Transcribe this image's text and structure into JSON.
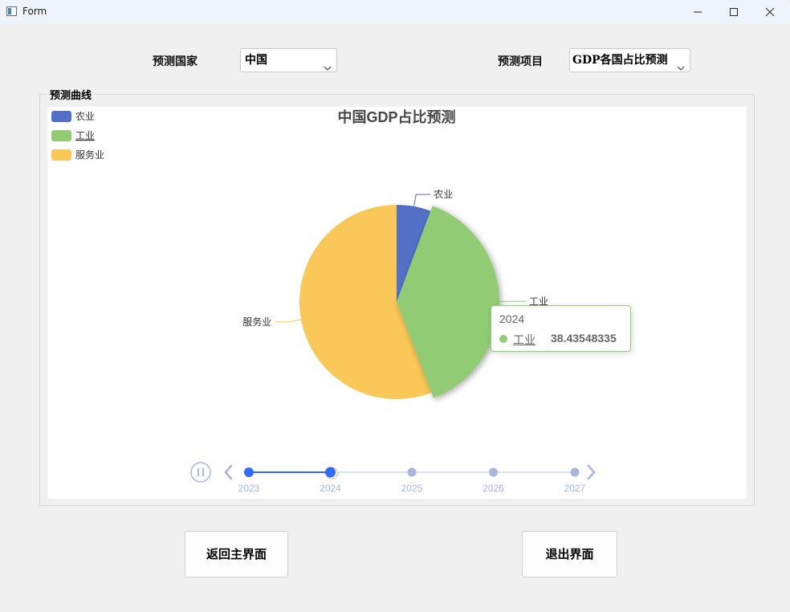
{
  "window": {
    "title": "Form"
  },
  "controls": {
    "country_label": "预测国家",
    "country_value": "中国",
    "item_label": "预测项目",
    "item_value": "GDP各国占比预测"
  },
  "group": {
    "title": "预测曲线"
  },
  "buttons": {
    "back": "返回主界面",
    "exit": "退出界面"
  },
  "tooltip": {
    "year": "2024",
    "name": "工业",
    "value": "38.43548335",
    "color": "#91cc75"
  },
  "chart_data": {
    "type": "pie",
    "title": "中国GDP占比预测",
    "categories": [
      "农业",
      "工业",
      "服务业"
    ],
    "values": [
      5.7,
      38.43548335,
      55.86
    ],
    "colors": [
      "#5470c6",
      "#91cc75",
      "#fac858"
    ],
    "legend": {
      "position": "top-left",
      "items": [
        "农业",
        "工业",
        "服务业"
      ]
    },
    "highlighted": "工业",
    "timeline": {
      "years": [
        "2023",
        "2024",
        "2025",
        "2026",
        "2027"
      ],
      "current": "2024"
    }
  }
}
